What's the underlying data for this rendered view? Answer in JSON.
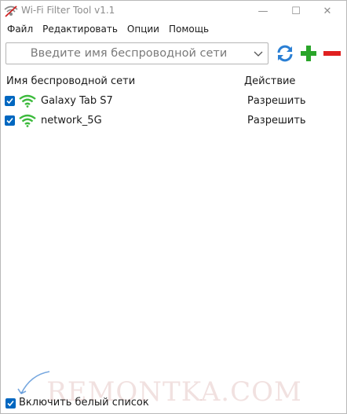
{
  "window": {
    "title": "Wi-Fi Filter Tool v1.1",
    "controls": {
      "minimize": "—",
      "maximize": "☐",
      "close": "✕"
    }
  },
  "menu": {
    "items": [
      {
        "label": "Файл"
      },
      {
        "label": "Редактировать"
      },
      {
        "label": "Опции"
      },
      {
        "label": "Помощь"
      }
    ]
  },
  "toolbar": {
    "ssid_placeholder": "Введите имя беспроводной сети",
    "refresh_icon": "refresh-icon",
    "add_icon": "plus-icon",
    "remove_icon": "minus-icon"
  },
  "table": {
    "columns": [
      "Имя беспроводной сети",
      "Действие"
    ],
    "rows": [
      {
        "checked": true,
        "name": "Galaxy Tab S7",
        "action": "Разрешить"
      },
      {
        "checked": true,
        "name": "network_5G",
        "action": "Разрешить"
      }
    ]
  },
  "footer": {
    "whitelist_checked": true,
    "whitelist_label": "Включить белый список"
  },
  "watermark": {
    "text": "REMONTKA.COM"
  },
  "colors": {
    "checkbox": "#0067c0",
    "wifi_green": "#3dba3d",
    "refresh_blue": "#2a7fd4",
    "add_green": "#2aa52a",
    "remove_red": "#e02020"
  }
}
